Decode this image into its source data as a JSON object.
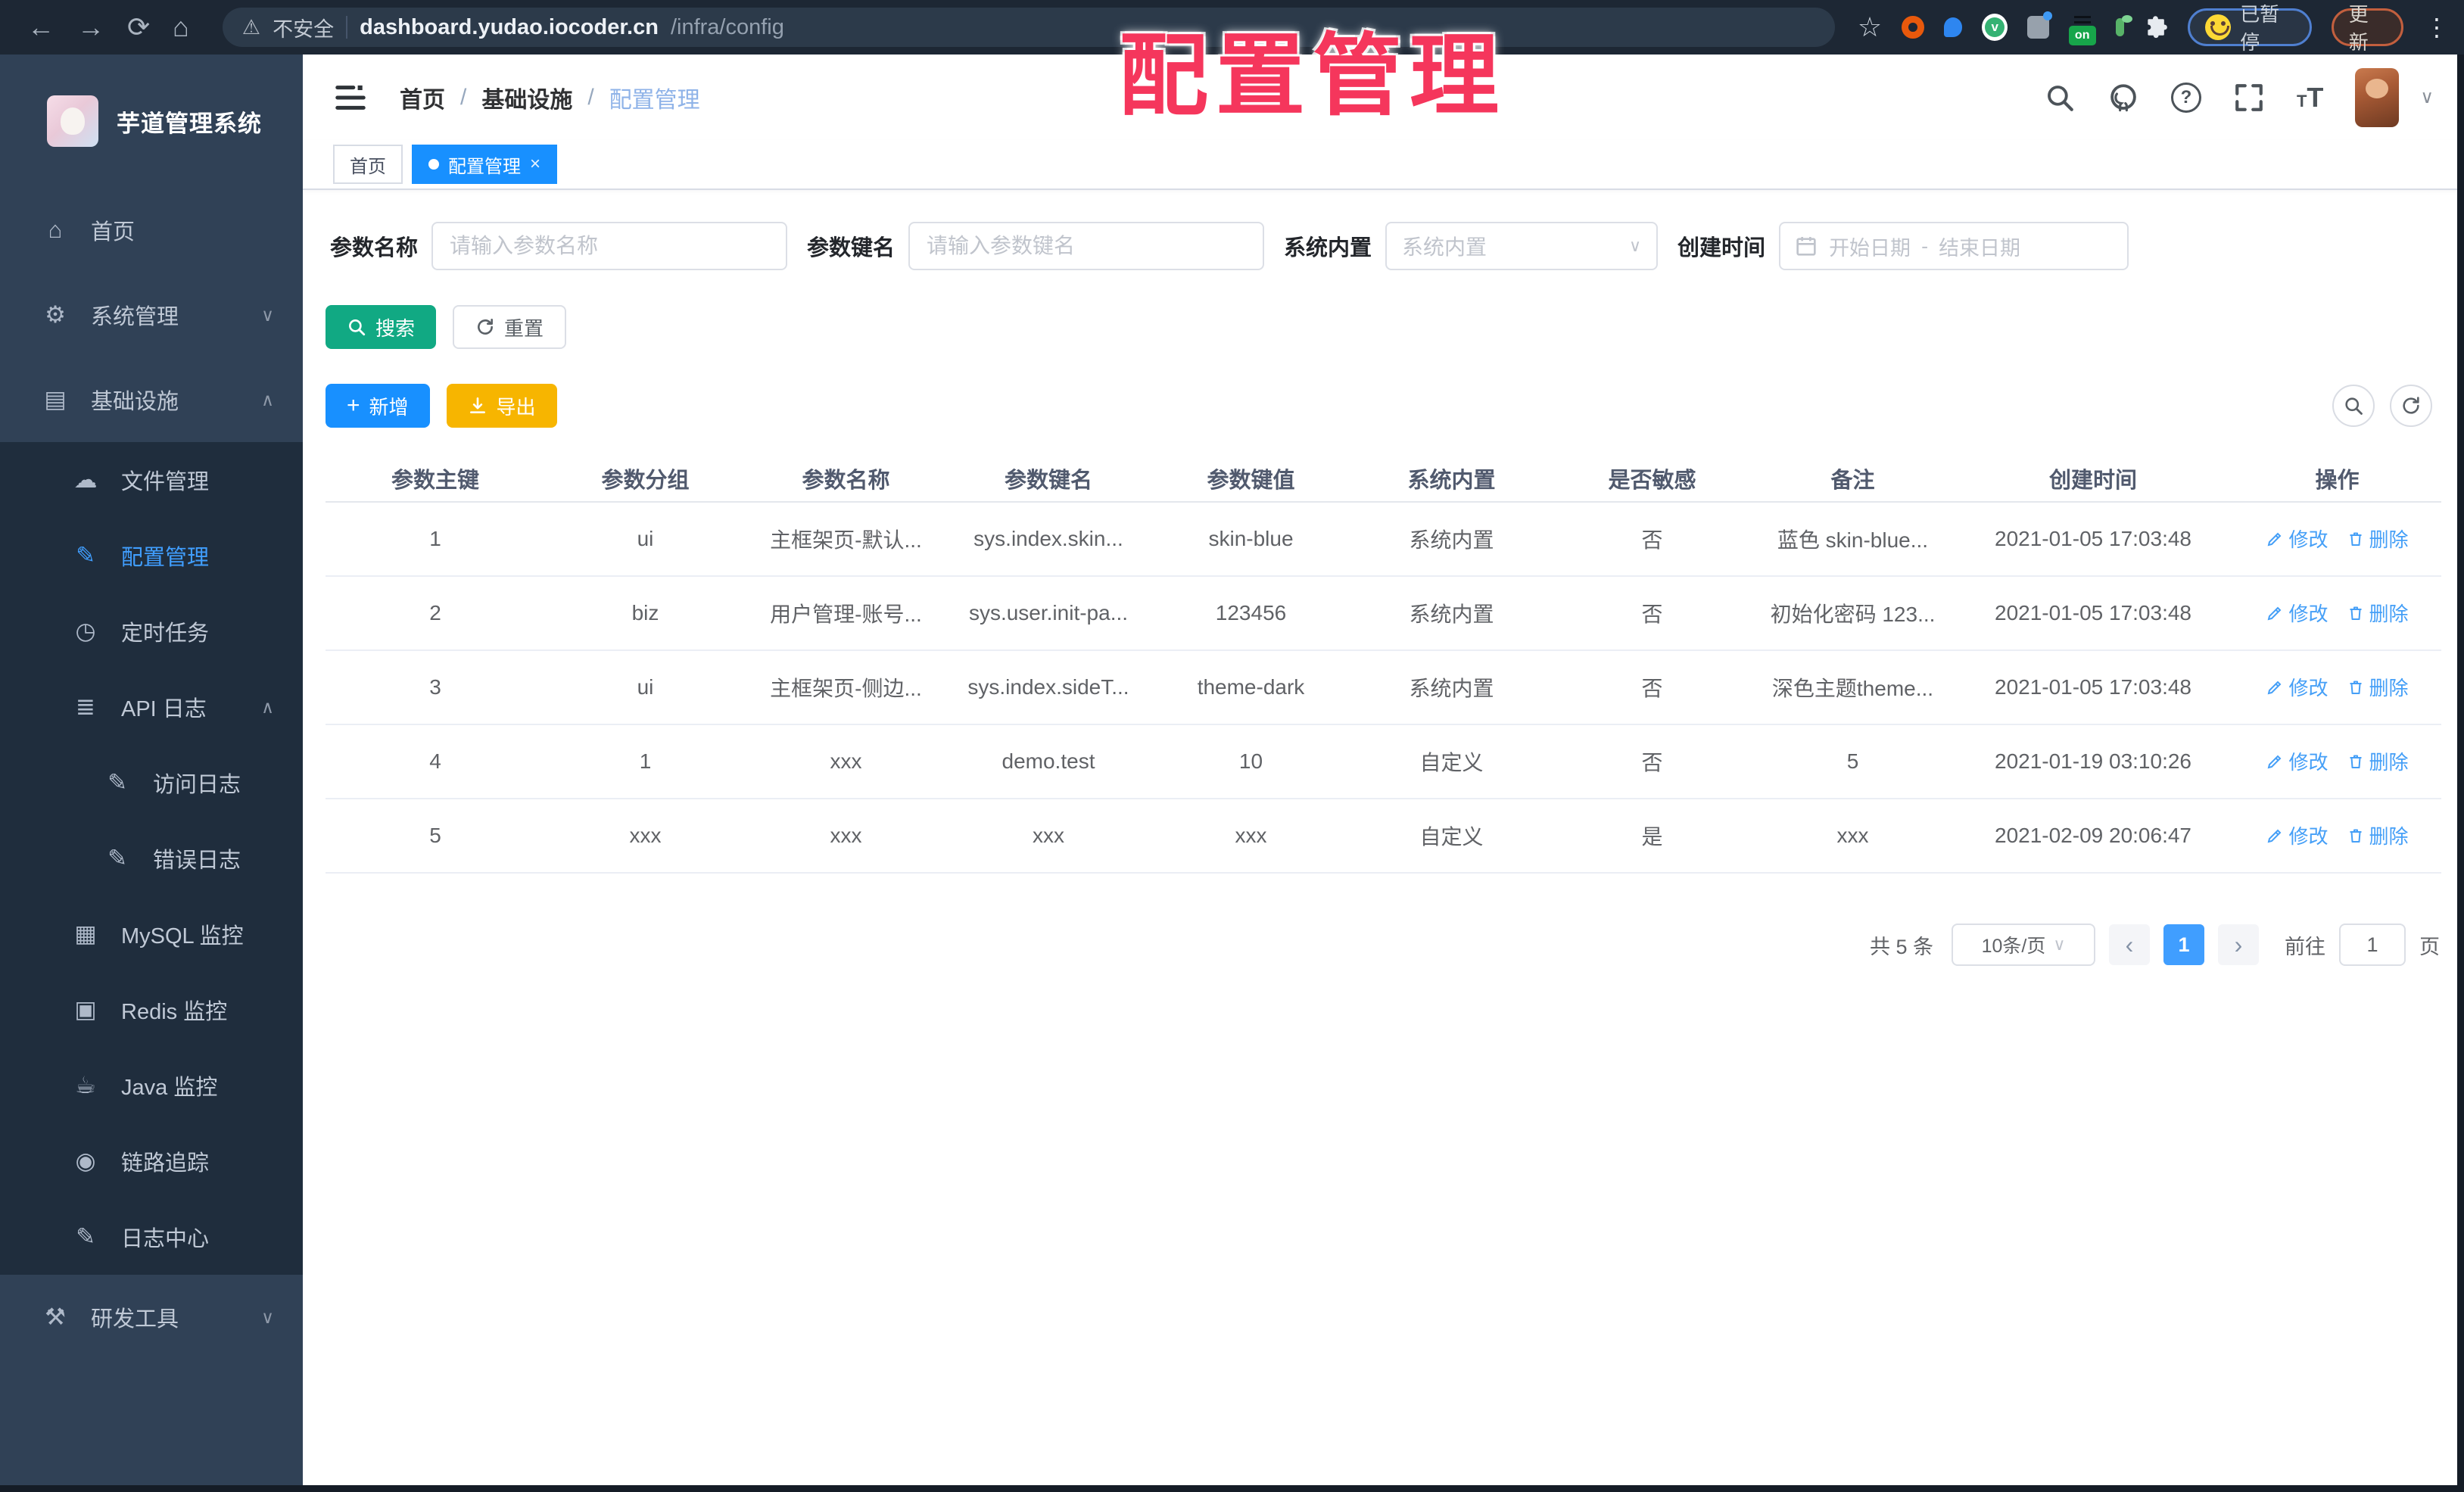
{
  "browser": {
    "security_label": "不安全",
    "url_host": "dashboard.yudao.iocoder.cn",
    "url_path": "/infra/config",
    "ext_on_label": "on",
    "paused_label": "已暂停",
    "update_label": "更新"
  },
  "annotation": {
    "text": "配置管理",
    "color": "#f5365c"
  },
  "icons": {
    "back": "←",
    "forward": "→",
    "reload": "⟳",
    "home": "⌂",
    "warning": "⚠",
    "star": "☆",
    "kebab": "⋮",
    "help": "?",
    "close": "×",
    "plus": "+",
    "caret_down": "∨",
    "caret_up": "∧",
    "prev": "‹",
    "next": "›",
    "font_large": "T",
    "font_small": "T",
    "vue_letter": "v"
  },
  "sidebar": {
    "title": "芋道管理系统",
    "items": [
      {
        "id": "home",
        "label": "首页",
        "glyph": "⌂",
        "level": 0
      },
      {
        "id": "system",
        "label": "系统管理",
        "glyph": "⚙",
        "level": 0,
        "arrow": "down"
      },
      {
        "id": "infra",
        "label": "基础设施",
        "glyph": "▤",
        "level": 0,
        "arrow": "up"
      },
      {
        "id": "file",
        "label": "文件管理",
        "glyph": "☁",
        "level": 1,
        "sub": true
      },
      {
        "id": "config",
        "label": "配置管理",
        "glyph": "✎",
        "level": 1,
        "sub": true,
        "active": true
      },
      {
        "id": "job",
        "label": "定时任务",
        "glyph": "◷",
        "level": 1,
        "sub": true
      },
      {
        "id": "api-log",
        "label": "API 日志",
        "glyph": "≣",
        "level": 1,
        "sub": true,
        "arrow": "up"
      },
      {
        "id": "access-log",
        "label": "访问日志",
        "glyph": "✎",
        "level": 2,
        "sub": true
      },
      {
        "id": "error-log",
        "label": "错误日志",
        "glyph": "✎",
        "level": 2,
        "sub": true
      },
      {
        "id": "mysql",
        "label": "MySQL 监控",
        "glyph": "▦",
        "level": 1,
        "sub": true
      },
      {
        "id": "redis",
        "label": "Redis 监控",
        "glyph": "▣",
        "level": 1,
        "sub": true
      },
      {
        "id": "java",
        "label": "Java 监控",
        "glyph": "☕",
        "level": 1,
        "sub": true
      },
      {
        "id": "trace",
        "label": "链路追踪",
        "glyph": "◉",
        "level": 1,
        "sub": true
      },
      {
        "id": "log-center",
        "label": "日志中心",
        "glyph": "✎",
        "level": 1,
        "sub": true
      },
      {
        "id": "dev-tools",
        "label": "研发工具",
        "glyph": "⚒",
        "level": 0,
        "arrow": "down"
      }
    ]
  },
  "header": {
    "breadcrumb": [
      "首页",
      "基础设施",
      "配置管理"
    ]
  },
  "tags": [
    {
      "label": "首页",
      "active": false
    },
    {
      "label": "配置管理",
      "active": true,
      "closable": true
    }
  ],
  "filters": {
    "name_label": "参数名称",
    "name_placeholder": "请输入参数名称",
    "key_label": "参数键名",
    "key_placeholder": "请输入参数键名",
    "type_label": "系统内置",
    "type_placeholder": "系统内置",
    "date_label": "创建时间",
    "date_start_placeholder": "开始日期",
    "date_separator": "-",
    "date_end_placeholder": "结束日期"
  },
  "actions": {
    "search": "搜索",
    "reset": "重置",
    "add": "新增",
    "export": "导出"
  },
  "table": {
    "columns": [
      "参数主键",
      "参数分组",
      "参数名称",
      "参数键名",
      "参数键值",
      "系统内置",
      "是否敏感",
      "备注",
      "创建时间",
      "操作"
    ],
    "edit_label": "修改",
    "delete_label": "删除",
    "rows": [
      {
        "id": "1",
        "group": "ui",
        "name": "主框架页-默认...",
        "key": "sys.index.skin...",
        "value": "skin-blue",
        "type": "系统内置",
        "sensitive": "否",
        "remark": "蓝色 skin-blue...",
        "created": "2021-01-05 17:03:48"
      },
      {
        "id": "2",
        "group": "biz",
        "name": "用户管理-账号...",
        "key": "sys.user.init-pa...",
        "value": "123456",
        "type": "系统内置",
        "sensitive": "否",
        "remark": "初始化密码 123...",
        "created": "2021-01-05 17:03:48"
      },
      {
        "id": "3",
        "group": "ui",
        "name": "主框架页-侧边...",
        "key": "sys.index.sideT...",
        "value": "theme-dark",
        "type": "系统内置",
        "sensitive": "否",
        "remark": "深色主题theme...",
        "created": "2021-01-05 17:03:48"
      },
      {
        "id": "4",
        "group": "1",
        "name": "xxx",
        "key": "demo.test",
        "value": "10",
        "type": "自定义",
        "sensitive": "否",
        "remark": "5",
        "created": "2021-01-19 03:10:26"
      },
      {
        "id": "5",
        "group": "xxx",
        "name": "xxx",
        "key": "xxx",
        "value": "xxx",
        "type": "自定义",
        "sensitive": "是",
        "remark": "xxx",
        "created": "2021-02-09 20:06:47"
      }
    ]
  },
  "pagination": {
    "total_label": "共 5 条",
    "page_size": "10条/页",
    "current_page": "1",
    "goto_label": "前往",
    "goto_value": "1",
    "page_unit": "页"
  },
  "colors": {
    "accent": "#409eff",
    "tag_active": "#1890ff",
    "success": "#11a983",
    "warning": "#f7b500"
  }
}
